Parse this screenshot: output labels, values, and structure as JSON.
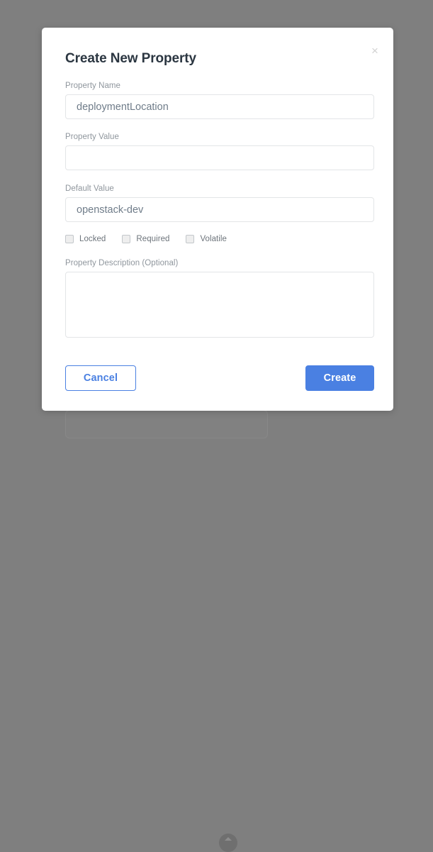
{
  "background": {
    "overlay_color": "#7f7f7f",
    "card": {
      "collapse_icon": "chevron-up-icon"
    }
  },
  "modal": {
    "title": "Create New Property",
    "close_label": "×",
    "fields": [
      {
        "name": "property-name",
        "label": "Property Name",
        "value": "deploymentLocation",
        "placeholder": ""
      },
      {
        "name": "property-value",
        "label": "Property Value",
        "value": "",
        "placeholder": ""
      },
      {
        "name": "default-value",
        "label": "Default Value",
        "value": "openstack-dev",
        "placeholder": ""
      }
    ],
    "checkboxes": [
      {
        "name": "locked",
        "label": "Locked",
        "checked": false
      },
      {
        "name": "required",
        "label": "Required",
        "checked": false
      },
      {
        "name": "volatile",
        "label": "Volatile",
        "checked": false
      }
    ],
    "description": {
      "label": "Property Description (Optional)",
      "value": "",
      "placeholder": ""
    },
    "buttons": {
      "cancel_label": "Cancel",
      "create_label": "Create"
    },
    "colors": {
      "accent": "#4a80e2",
      "title_text": "#2b3641",
      "label_text": "#8f969d",
      "input_border": "#e3e5e7",
      "input_text": "#6f7c89"
    }
  }
}
